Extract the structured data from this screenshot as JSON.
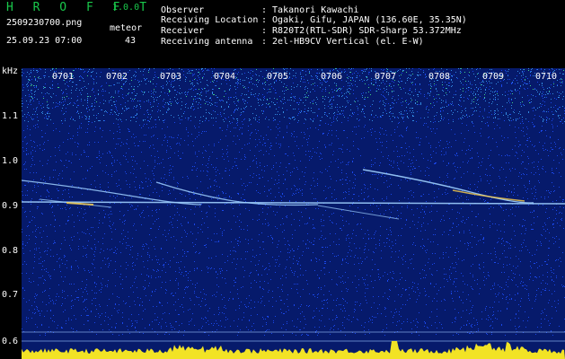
{
  "logo": "H R O F F T",
  "version": "1.0.0",
  "filename": "2509230700.png",
  "datetime": "25.09.23 07:00",
  "meteor_label": "meteor",
  "meteor_count": "43",
  "info": {
    "observer_label": "Observer",
    "observer_value": ": Takanori Kawachi",
    "location_label": "Receiving Location",
    "location_value": ": Ogaki, Gifu, JAPAN (136.60E, 35.35N)",
    "receiver_label": "Receiver",
    "receiver_value": ": R820T2(RTL-SDR) SDR-Sharp 53.372MHz",
    "antenna_label": "Receiving antenna",
    "antenna_value": ": 2el-HB9CV Vertical (el. E-W)"
  },
  "y_axis": {
    "unit": "kHz",
    "ticks": [
      "1.1",
      "1.0",
      "0.9",
      "0.8",
      "0.7",
      "0.6"
    ]
  },
  "x_axis": {
    "ticks": [
      "0701",
      "0702",
      "0703",
      "0704",
      "0705",
      "0706",
      "0707",
      "0708",
      "0709",
      "0710"
    ]
  },
  "colors": {
    "background": "#061a6b",
    "noise": "#1e50ff",
    "trace": "#9fd0ff",
    "hot": "#ffd24a",
    "strip": "#ffee22"
  }
}
